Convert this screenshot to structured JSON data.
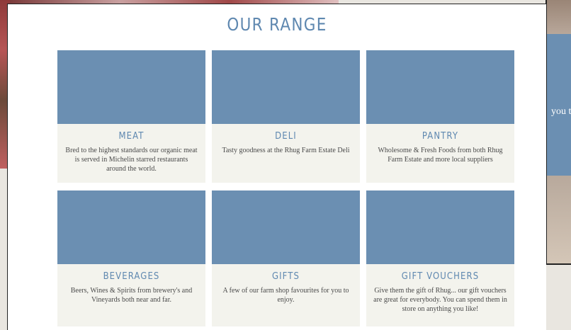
{
  "section": {
    "title": "OUR RANGE",
    "cards": [
      {
        "name": "MEAT",
        "description": "Bred to the highest standards our organic meat is served in Michelin starred restaurants around the world."
      },
      {
        "name": "DELI",
        "description": "Tasty goodness at the Rhug Farm Estate Deli"
      },
      {
        "name": "PANTRY",
        "description": "Wholesome & Fresh Foods from both Rhug Farm Estate and more local suppliers"
      },
      {
        "name": "BEVERAGES",
        "description": "Beers, Wines & Spirits from brewery's and Vineyards both near and far."
      },
      {
        "name": "GIFTS",
        "description": "A few of our farm shop favourites for you to enjoy."
      },
      {
        "name": "GIFT VOUCHERS",
        "description": "Give them the gift of Rhug... our gift vouchers are great for everybody. You can spend them in store on anything you like!"
      }
    ]
  },
  "background": {
    "right_peek_text": "you t"
  },
  "colors": {
    "accent": "#5f88b0",
    "image_placeholder": "#6b8fb2",
    "card_bg": "#f3f3ed"
  }
}
